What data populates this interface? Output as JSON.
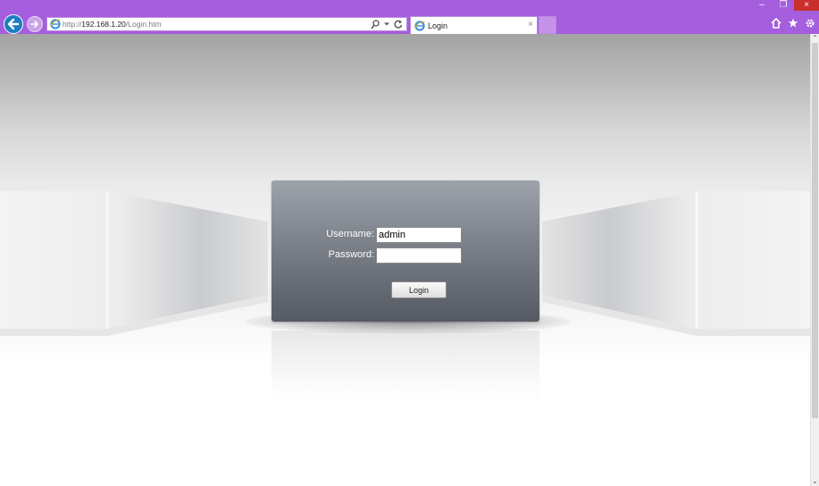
{
  "browser": {
    "url_prefix": "http://",
    "url_host": "192.168.1.20",
    "url_path": "/Login.htm",
    "tab_title": "Login",
    "tab_close": "×",
    "window_controls": {
      "minimize": "–",
      "restore": "❐",
      "close": "×"
    },
    "icons": [
      "back-icon",
      "forward-icon",
      "ie-icon",
      "search-icon",
      "refresh-icon",
      "home-icon",
      "favorites-star-icon",
      "settings-gear-icon"
    ]
  },
  "login": {
    "username_label": "Username:",
    "username_value": "admin",
    "password_label": "Password:",
    "password_value": "",
    "button_label": "Login"
  },
  "colors": {
    "chrome_accent": "#a45ede",
    "back_button": "#1c7ec4",
    "panel_top": "#9ea3ab",
    "panel_bottom": "#555a63"
  }
}
